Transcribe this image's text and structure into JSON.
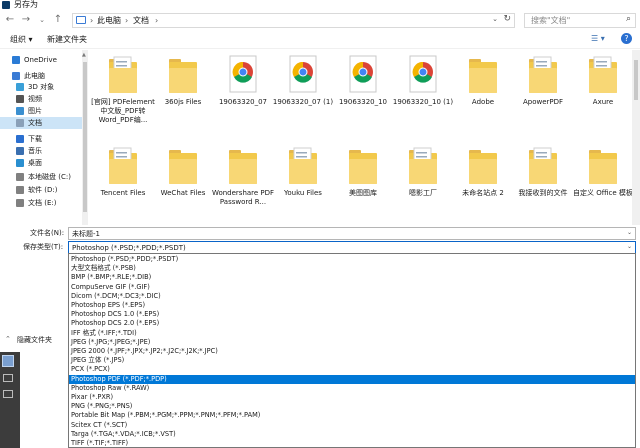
{
  "window": {
    "title": "另存为"
  },
  "address": {
    "crumbs": [
      "此电脑",
      "文档"
    ],
    "search_placeholder": "搜索\"文档\""
  },
  "toolbar": {
    "organize": "组织 ▾",
    "new_folder": "新建文件夹"
  },
  "sidebar": {
    "items": [
      {
        "label": "OneDrive",
        "icon": "cloud-icon"
      },
      {
        "label": "此电脑",
        "icon": "pc-icon"
      },
      {
        "label": "3D 对象",
        "icon": "cube-icon"
      },
      {
        "label": "视频",
        "icon": "video-icon"
      },
      {
        "label": "图片",
        "icon": "picture-icon"
      },
      {
        "label": "文档",
        "icon": "document-icon",
        "selected": true
      },
      {
        "label": "下载",
        "icon": "download-icon"
      },
      {
        "label": "音乐",
        "icon": "music-icon"
      },
      {
        "label": "桌面",
        "icon": "desktop-icon"
      },
      {
        "label": "本地磁盘 (C:)",
        "icon": "drive-icon"
      },
      {
        "label": "软件 (D:)",
        "icon": "drive-icon"
      },
      {
        "label": "文档 (E:)",
        "icon": "drive-icon"
      }
    ]
  },
  "files": [
    {
      "label": "[官网] PDFelement中文版_PDF转Word_PDF编...",
      "type": "folder-doc"
    },
    {
      "label": "360js Files",
      "type": "folder"
    },
    {
      "label": "19063320_07",
      "type": "chrome"
    },
    {
      "label": "19063320_07 (1)",
      "type": "chrome"
    },
    {
      "label": "19063320_10",
      "type": "chrome"
    },
    {
      "label": "19063320_10 (1)",
      "type": "chrome"
    },
    {
      "label": "Adobe",
      "type": "folder"
    },
    {
      "label": "ApowerPDF",
      "type": "folder-doc"
    },
    {
      "label": "Axure",
      "type": "folder-doc"
    },
    {
      "label": "Tencent Files",
      "type": "folder-doc"
    },
    {
      "label": "WeChat Files",
      "type": "folder"
    },
    {
      "label": "Wondershare PDF Password R...",
      "type": "folder"
    },
    {
      "label": "Youku Files",
      "type": "folder-doc"
    },
    {
      "label": "美图图库",
      "type": "folder"
    },
    {
      "label": "嗯影工厂",
      "type": "folder-doc"
    },
    {
      "label": "未命名站点 2",
      "type": "folder"
    },
    {
      "label": "我接收到的文件",
      "type": "folder-doc"
    },
    {
      "label": "自定义 Office 模板",
      "type": "folder"
    }
  ],
  "form": {
    "filename_label": "文件名(N):",
    "filename_value": "未标题-1",
    "type_label": "保存类型(T):",
    "type_value": "Photoshop (*.PSD;*.PDD;*.PSDT)"
  },
  "dropdown": {
    "options": [
      "Photoshop (*.PSD;*.PDD;*.PSDT)",
      "大型文档格式 (*.PSB)",
      "BMP (*.BMP;*.RLE;*.DIB)",
      "CompuServe GIF (*.GIF)",
      "Dicom (*.DCM;*.DC3;*.DIC)",
      "Photoshop EPS (*.EPS)",
      "Photoshop DCS 1.0 (*.EPS)",
      "Photoshop DCS 2.0 (*.EPS)",
      "IFF 格式 (*.IFF;*.TDI)",
      "JPEG (*.JPG;*.JPEG;*.JPE)",
      "JPEG 2000 (*.JPF;*.JPX;*.JP2;*.J2C;*.J2K;*.JPC)",
      "JPEG 立体 (*.JPS)",
      "PCX (*.PCX)",
      "Photoshop PDF (*.PDF;*.PDP)",
      "Photoshop Raw (*.RAW)",
      "Pixar (*.PXR)",
      "PNG (*.PNG;*.PNS)",
      "Portable Bit Map (*.PBM;*.PGM;*.PPM;*.PNM;*.PFM;*.PAM)",
      "Scitex CT (*.SCT)",
      "Targa (*.TGA;*.VDA;*.ICB;*.VST)",
      "TIFF (*.TIF;*.TIFF)"
    ],
    "selected_index": 13
  },
  "footer": {
    "hide_folders": "隐藏文件夹"
  },
  "colors": {
    "accent": "#0078d7",
    "selection": "#cce4f7",
    "folder": "#f8d775"
  }
}
